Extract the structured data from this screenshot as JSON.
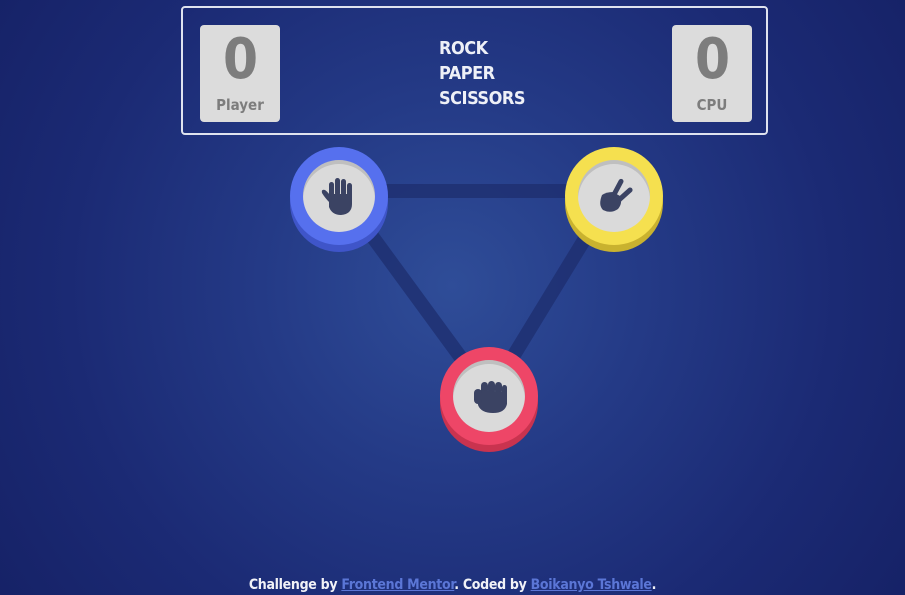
{
  "header": {
    "title_lines": [
      "ROCK",
      "PAPER",
      "SCISSORS"
    ],
    "player": {
      "score": "0",
      "label": "Player"
    },
    "cpu": {
      "score": "0",
      "label": "CPU"
    }
  },
  "choices": [
    {
      "name": "paper",
      "icon": "hand-paper-icon",
      "ring_color": "#5670ee"
    },
    {
      "name": "scissors",
      "icon": "hand-scissors-icon",
      "ring_color": "#f5e04f"
    },
    {
      "name": "rock",
      "icon": "hand-rock-icon",
      "ring_color": "#ee4667"
    }
  ],
  "footer": {
    "prefix": "Challenge by ",
    "link1_text": "Frontend Mentor",
    "middle": ". Coded by ",
    "link2_text": "Boikanyo Tshwale",
    "suffix": "."
  },
  "colors": {
    "background": "#243a86",
    "score_box": "#dcdcdc",
    "link": "#5b76d6"
  }
}
